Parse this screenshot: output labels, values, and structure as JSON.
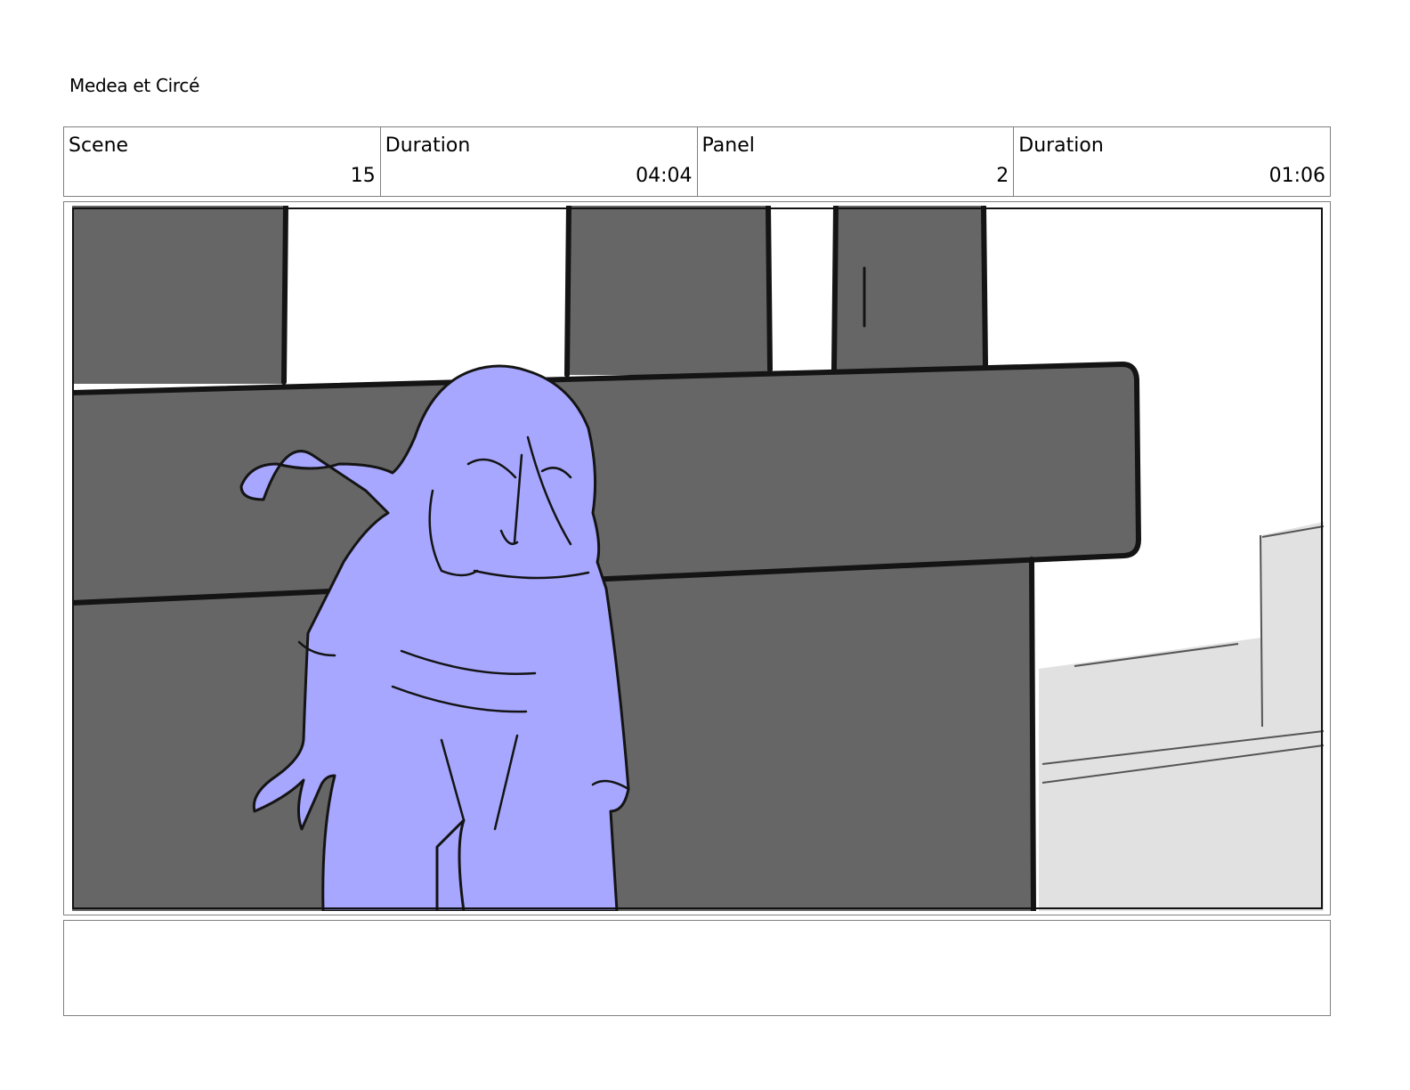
{
  "document": {
    "title": "Medea et Circé"
  },
  "info": {
    "scene_label": "Scene",
    "scene_value": "15",
    "scene_duration_label": "Duration",
    "scene_duration_value": "04:04",
    "panel_label": "Panel",
    "panel_value": "2",
    "panel_duration_label": "Duration",
    "panel_duration_value": "01:06"
  },
  "colors": {
    "wall": "#666666",
    "sky": "#ffffff",
    "character": "#a7a7ff",
    "street": "#e1e1e1",
    "ink": "#141414"
  },
  "notes": {
    "text": ""
  }
}
